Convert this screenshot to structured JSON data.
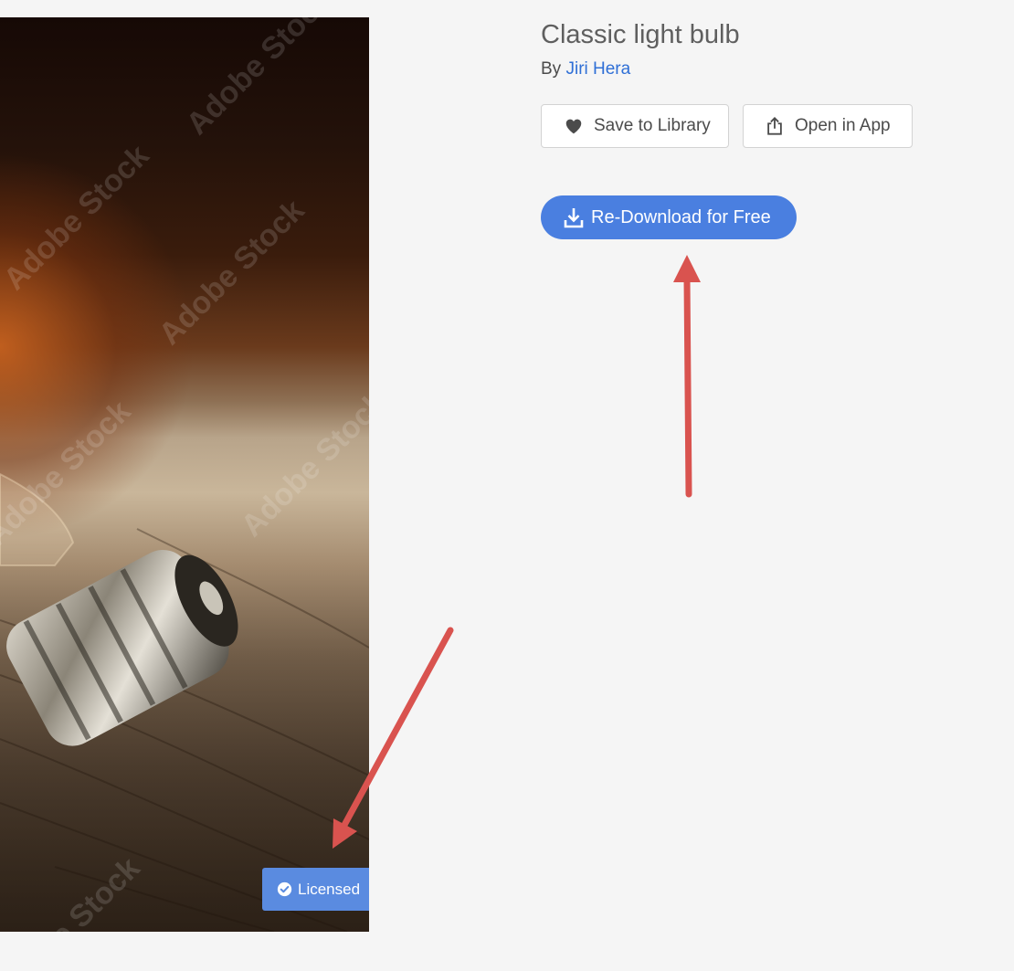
{
  "asset": {
    "title": "Classic light bulb",
    "by_label": "By",
    "author": "Jiri Hera",
    "watermark_text": "Adobe Stock",
    "badge": {
      "label": "Licensed",
      "icon": "check-circle-icon"
    }
  },
  "actions": {
    "save": {
      "label": "Save to Library",
      "icon": "heart-icon"
    },
    "open": {
      "label": "Open in App",
      "icon": "share-icon"
    },
    "download": {
      "label": "Re-Download for Free",
      "icon": "download-icon"
    }
  },
  "annotations": {
    "arrow_color": "#d9534f"
  },
  "colors": {
    "page_background": "#f5f5f5",
    "primary": "#4a7fe0",
    "badge": "#5a8be0",
    "link": "#2f6fd6"
  }
}
